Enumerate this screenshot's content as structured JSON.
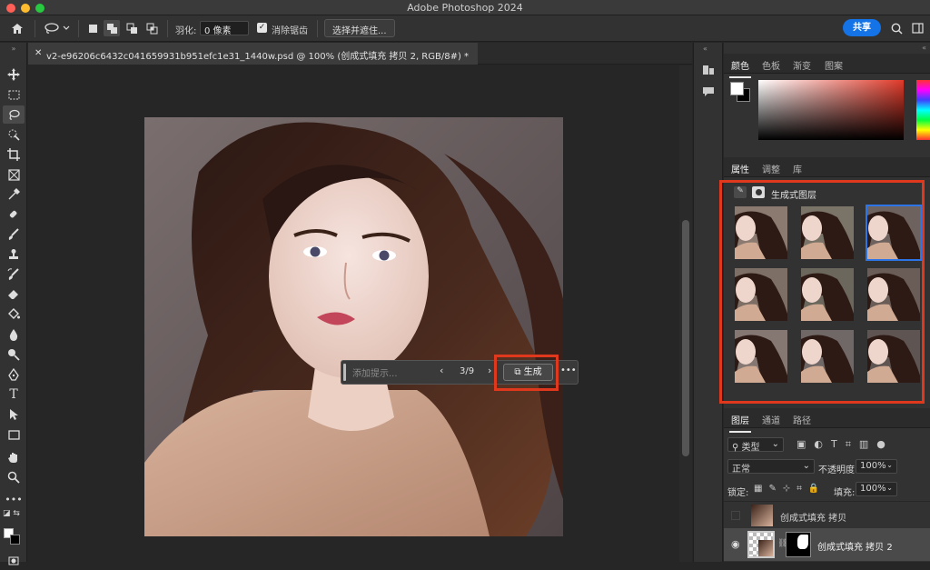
{
  "app_title": "Adobe Photoshop 2024",
  "options": {
    "feather_label": "羽化:",
    "feather_value": "0 像素",
    "antialias_label": "消除锯齿",
    "select_mask_label": "选择并遮住...",
    "share_label": "共享"
  },
  "document": {
    "tab_title": "v2-e96206c6432c041659931b951efc1e31_1440w.psd @ 100% (创成式填充 拷贝 2, RGB/8#) *"
  },
  "contextual_bar": {
    "prompt_placeholder": "添加提示...",
    "variation_counter": "3/9",
    "generate_label": "生成"
  },
  "color_panel": {
    "tabs": [
      "颜色",
      "色板",
      "渐变",
      "图案"
    ],
    "accent_red": "#e03a2a"
  },
  "properties_panel": {
    "tabs": [
      "属性",
      "调整",
      "库"
    ],
    "layer_type_label": "生成式图层",
    "variations_total": 9,
    "selected_variation": 3
  },
  "layers_panel": {
    "tabs": [
      "图层",
      "通道",
      "路径"
    ],
    "filter_label": "类型",
    "blend_mode": "正常",
    "opacity_label": "不透明度:",
    "opacity_value": "100%",
    "lock_label": "锁定:",
    "fill_label": "填充:",
    "fill_value": "100%",
    "layers": [
      {
        "name": "创成式填充 拷贝",
        "visible": false
      },
      {
        "name": "创成式填充 拷贝 2",
        "visible": true
      }
    ]
  },
  "colors": {
    "highlight_box": "#e0381c",
    "selection_blue": "#2d74e6",
    "share_blue": "#1473e6"
  }
}
